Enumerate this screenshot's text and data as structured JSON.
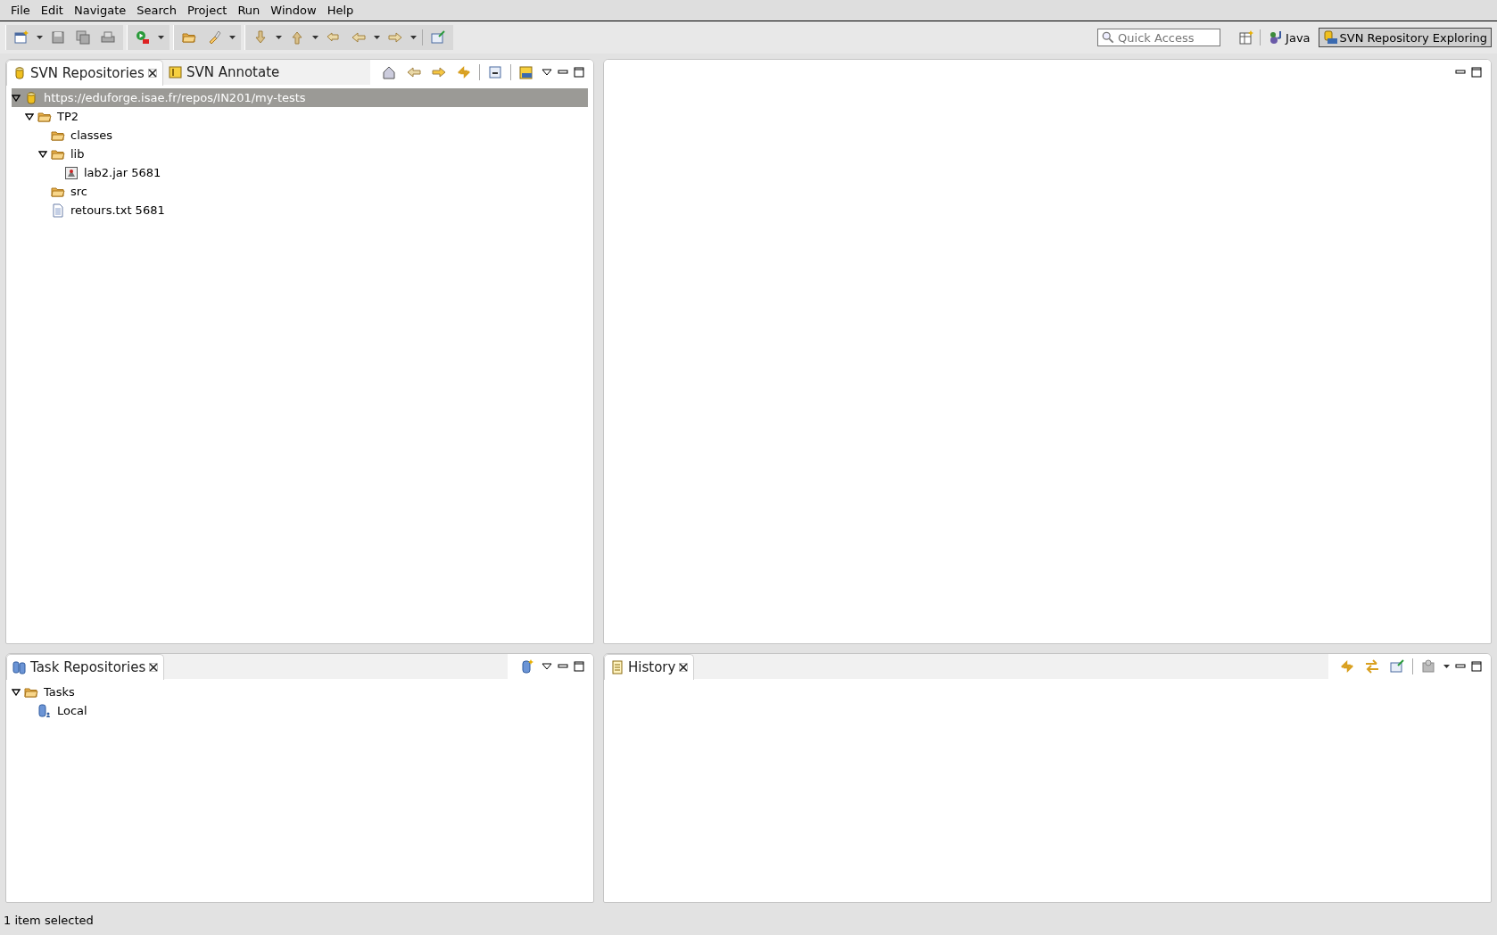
{
  "menu_bar": [
    "File",
    "Edit",
    "Navigate",
    "Search",
    "Project",
    "Run",
    "Window",
    "Help"
  ],
  "toolbar": {
    "quick_access": {
      "placeholder": "Quick Access"
    },
    "perspectives": [
      {
        "label": "Java",
        "selected": false
      },
      {
        "label": "SVN Repository Exploring",
        "selected": true
      }
    ]
  },
  "repositories_panel": {
    "tabs": [
      {
        "label": "SVN Repositories",
        "selected": true,
        "closable": true
      },
      {
        "label": "SVN Annotate",
        "selected": false,
        "closable": false
      }
    ],
    "tree": [
      {
        "label": "https://eduforge.isae.fr/repos/IN201/my-tests",
        "kind": "repository",
        "expanded": true,
        "selected": true,
        "children": [
          {
            "label": "TP2",
            "kind": "folder",
            "expanded": true,
            "selected": false,
            "children": [
              {
                "label": "classes",
                "kind": "folder",
                "selected": false
              },
              {
                "label": "lib",
                "kind": "folder",
                "expanded": true,
                "selected": false,
                "children": [
                  {
                    "label": "lab2.jar 5681",
                    "kind": "jar",
                    "selected": false
                  }
                ]
              },
              {
                "label": "src",
                "kind": "folder",
                "selected": false
              },
              {
                "label": "retours.txt 5681",
                "kind": "file",
                "selected": false
              }
            ]
          }
        ]
      }
    ]
  },
  "task_repositories_panel": {
    "tabs": [
      {
        "label": "Task Repositories",
        "selected": true,
        "closable": true
      }
    ],
    "tree": [
      {
        "label": "Tasks",
        "kind": "folder",
        "expanded": true,
        "selected": false,
        "children": [
          {
            "label": "Local",
            "kind": "task-repository",
            "selected": false
          }
        ]
      }
    ]
  },
  "history_panel": {
    "tabs": [
      {
        "label": "History",
        "selected": true,
        "closable": true
      }
    ]
  },
  "status_bar": {
    "message": "1 item selected"
  }
}
